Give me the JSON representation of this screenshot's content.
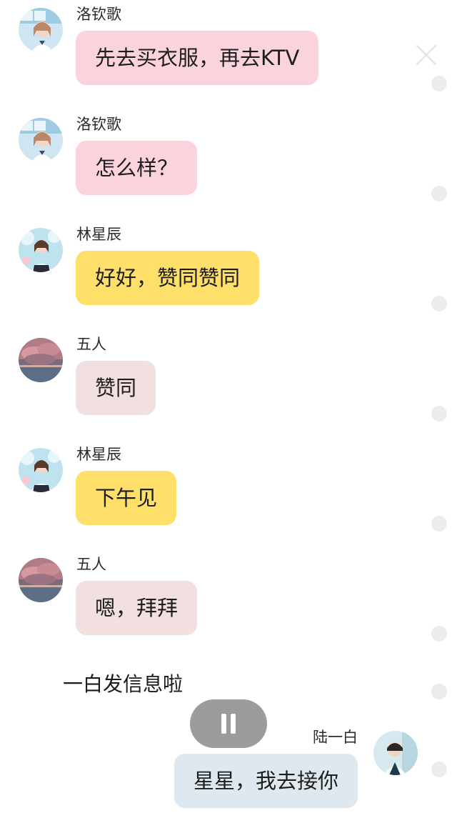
{
  "messages": [
    {
      "sender": "洛钦歌",
      "text": "先去买衣服，再去KTV",
      "avatar": "girl-avatar-window"
    },
    {
      "sender": "洛钦歌",
      "text": "怎么样？",
      "avatar": "girl-avatar-window"
    },
    {
      "sender": "林星辰",
      "text": "好好，赞同赞同",
      "avatar": "girl-avatar-sky"
    },
    {
      "sender": "五人",
      "text": "赞同",
      "avatar": "sunset-clouds-avatar"
    },
    {
      "sender": "林星辰",
      "text": "下午见",
      "avatar": "girl-avatar-sky"
    },
    {
      "sender": "五人",
      "text": "嗯，拜拜",
      "avatar": "sunset-clouds-avatar"
    }
  ],
  "narration": "一白发信息啦",
  "outgoing": {
    "sender": "陆一白",
    "text": "星星，我去接你",
    "avatar": "boy-avatar"
  },
  "controls": {
    "pause": "pause-icon",
    "close": "close-icon"
  },
  "colors": {
    "pink_bubble": "#fbd3dd",
    "yellow_bubble": "#fddf6a",
    "beige_bubble": "#f2dfdf",
    "blue_bubble": "#dfe8ee",
    "pause_button": "#9c9c9c"
  }
}
